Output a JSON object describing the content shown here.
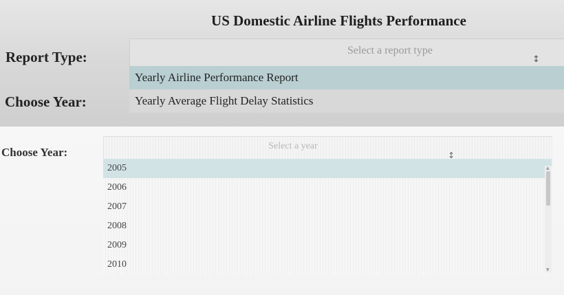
{
  "header": {
    "title": "US Domestic Airline Flights Performance"
  },
  "report_type": {
    "label": "Report Type:",
    "placeholder": "Select a report type",
    "caret_icon": "chevron-updown-icon",
    "options": [
      {
        "label": "Yearly Airline Performance Report",
        "highlighted": true
      },
      {
        "label": "Yearly Average Flight Delay Statistics",
        "highlighted": false
      }
    ]
  },
  "year_top": {
    "label": "Choose Year:"
  },
  "year_select": {
    "label": "Choose Year:",
    "placeholder": "Select a year",
    "caret_icon": "chevron-updown-icon",
    "options": [
      {
        "label": "2005",
        "highlighted": true
      },
      {
        "label": "2006",
        "highlighted": false
      },
      {
        "label": "2007",
        "highlighted": false
      },
      {
        "label": "2008",
        "highlighted": false
      },
      {
        "label": "2009",
        "highlighted": false
      },
      {
        "label": "2010",
        "highlighted": false
      }
    ]
  },
  "colors": {
    "highlight_top": "#b9cfd2",
    "highlight_bottom": "#d2e3e6"
  }
}
